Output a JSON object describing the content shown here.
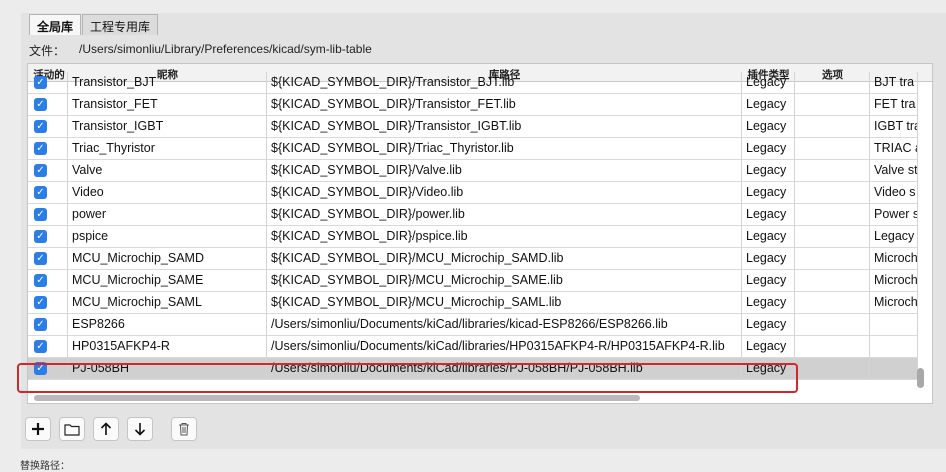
{
  "tabs": [
    "全局库",
    "工程专用库"
  ],
  "file": {
    "label": "文件：",
    "path": "/Users/simonliu/Library/Preferences/kicad/sym-lib-table"
  },
  "columns": [
    "活动的",
    "昵称",
    "库路径",
    "插件类型",
    "选项",
    ""
  ],
  "rows": [
    {
      "active": true,
      "nickname": "Transistor_BJT",
      "path": "${KICAD_SYMBOL_DIR}/Transistor_BJT.lib",
      "plugin": "Legacy",
      "options": "",
      "description": "BJT tra"
    },
    {
      "active": true,
      "nickname": "Transistor_FET",
      "path": "${KICAD_SYMBOL_DIR}/Transistor_FET.lib",
      "plugin": "Legacy",
      "options": "",
      "description": "FET tra"
    },
    {
      "active": true,
      "nickname": "Transistor_IGBT",
      "path": "${KICAD_SYMBOL_DIR}/Transistor_IGBT.lib",
      "plugin": "Legacy",
      "options": "",
      "description": "IGBT tra"
    },
    {
      "active": true,
      "nickname": "Triac_Thyristor",
      "path": "${KICAD_SYMBOL_DIR}/Triac_Thyristor.lib",
      "plugin": "Legacy",
      "options": "",
      "description": "TRIAC a"
    },
    {
      "active": true,
      "nickname": "Valve",
      "path": "${KICAD_SYMBOL_DIR}/Valve.lib",
      "plugin": "Legacy",
      "options": "",
      "description": "Valve st"
    },
    {
      "active": true,
      "nickname": "Video",
      "path": "${KICAD_SYMBOL_DIR}/Video.lib",
      "plugin": "Legacy",
      "options": "",
      "description": "Video s"
    },
    {
      "active": true,
      "nickname": "power",
      "path": "${KICAD_SYMBOL_DIR}/power.lib",
      "plugin": "Legacy",
      "options": "",
      "description": "Power s"
    },
    {
      "active": true,
      "nickname": "pspice",
      "path": "${KICAD_SYMBOL_DIR}/pspice.lib",
      "plugin": "Legacy",
      "options": "",
      "description": "Legacy"
    },
    {
      "active": true,
      "nickname": "MCU_Microchip_SAMD",
      "path": "${KICAD_SYMBOL_DIR}/MCU_Microchip_SAMD.lib",
      "plugin": "Legacy",
      "options": "",
      "description": "Microch"
    },
    {
      "active": true,
      "nickname": "MCU_Microchip_SAME",
      "path": "${KICAD_SYMBOL_DIR}/MCU_Microchip_SAME.lib",
      "plugin": "Legacy",
      "options": "",
      "description": "Microch"
    },
    {
      "active": true,
      "nickname": "MCU_Microchip_SAML",
      "path": "${KICAD_SYMBOL_DIR}/MCU_Microchip_SAML.lib",
      "plugin": "Legacy",
      "options": "",
      "description": "Microch"
    },
    {
      "active": true,
      "nickname": "ESP8266",
      "path": "/Users/simonliu/Documents/kiCad/libraries/kicad-ESP8266/ESP8266.lib",
      "plugin": "Legacy",
      "options": "",
      "description": ""
    },
    {
      "active": true,
      "nickname": "HP0315AFKP4-R",
      "path": "/Users/simonliu/Documents/kiCad/libraries/HP0315AFKP4-R/HP0315AFKP4-R.lib",
      "plugin": "Legacy",
      "options": "",
      "description": ""
    },
    {
      "active": true,
      "nickname": "PJ-058BH",
      "path": "/Users/simonliu/Documents/kiCad/libraries/PJ-058BH/PJ-058BH.lib",
      "plugin": "Legacy",
      "options": "",
      "description": "",
      "selected": true
    }
  ],
  "toolbar": [
    "add-icon",
    "folder-icon",
    "arrow-up-icon",
    "arrow-down-icon",
    "trash-icon"
  ],
  "substitution_label": "替换路径：",
  "colors": {
    "checkbox": "#2b7de9",
    "highlight": "#d2272e",
    "selected_row": "#d0d0d0"
  }
}
